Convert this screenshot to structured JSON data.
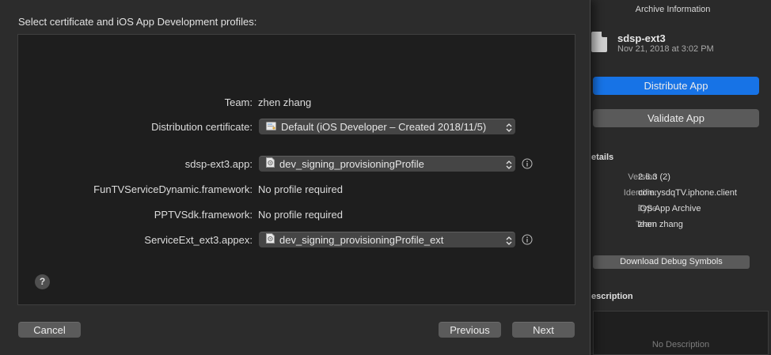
{
  "archive": {
    "header": "Archive Information",
    "name": "sdsp-ext3",
    "date": "Nov 21, 2018 at 3:02 PM",
    "distribute_label": "Distribute App",
    "validate_label": "Validate App",
    "details_heading": "etails",
    "details": [
      {
        "key": "Version",
        "value": "2.6.3 (2)"
      },
      {
        "key": "Identifier",
        "value": "com.ysdqTV.iphone.client"
      },
      {
        "key": "Type",
        "value": "iOS App Archive"
      },
      {
        "key": "Team",
        "value": "zhen zhang"
      }
    ],
    "download_label": "Download Debug Symbols",
    "description_heading": "escription",
    "description_placeholder": "No Description"
  },
  "sheet": {
    "heading": "Select certificate and iOS App Development profiles:",
    "team": {
      "label": "Team:",
      "value": "zhen zhang"
    },
    "certificate": {
      "label": "Distribution certificate:",
      "value": "Default (iOS Developer – Created 2018/11/5)"
    },
    "app": {
      "label": "sdsp-ext3.app:",
      "value": "dev_signing_provisioningProfile"
    },
    "fun": {
      "label": "FunTVServiceDynamic.framework:",
      "value": "No profile required"
    },
    "pptv": {
      "label": "PPTVSdk.framework:",
      "value": "No profile required"
    },
    "ext": {
      "label": "ServiceExt_ext3.appex:",
      "value": "dev_signing_provisioningProfile_ext"
    },
    "help_label": "?",
    "cancel_label": "Cancel",
    "previous_label": "Previous",
    "next_label": "Next"
  },
  "icons": {
    "certificate": "certificate-icon",
    "profile": "provisioning-profile-icon",
    "info": "info-icon",
    "archive": "archive-document-icon",
    "popup_arrows": "up-down-chevron-icon"
  },
  "colors": {
    "accent": "#1773e6",
    "background": "#1e1e1e",
    "sheet": "#2c2c2c"
  }
}
